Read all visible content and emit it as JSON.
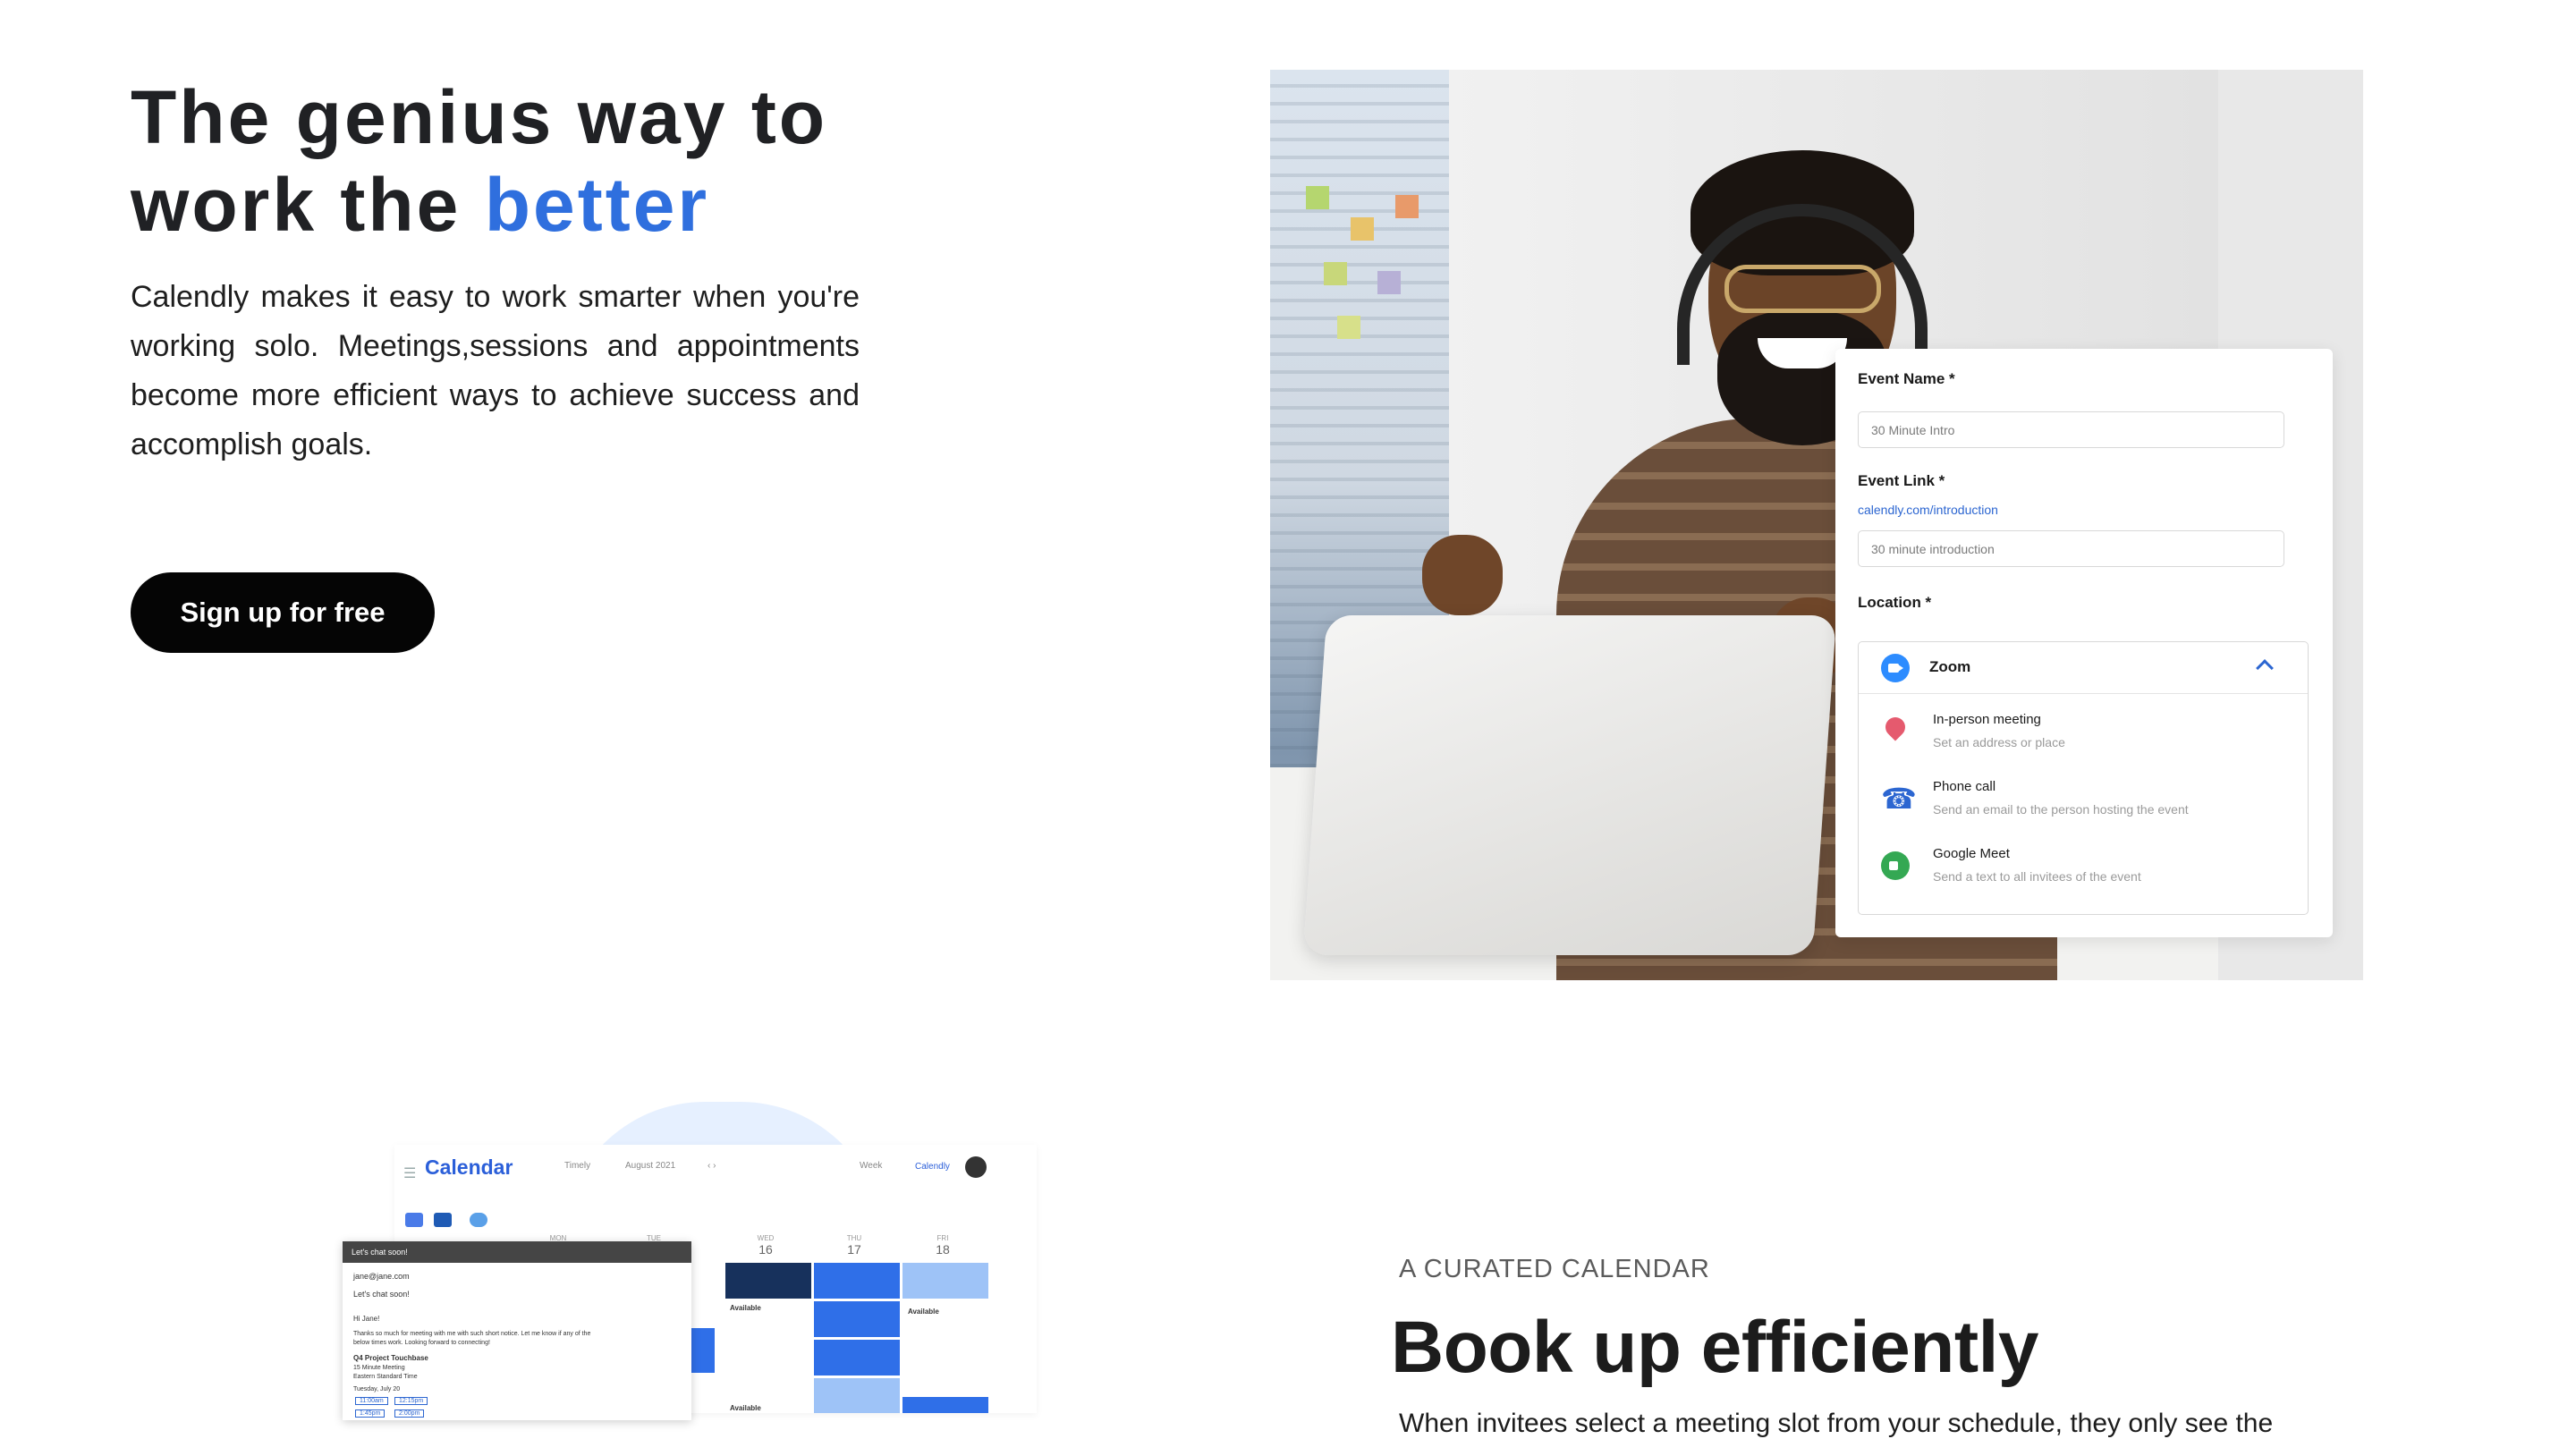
{
  "hero": {
    "title_line1": "The genius way to",
    "title_line2_prefix": "work the ",
    "title_line2_accent": "better",
    "description": "Calendly makes it easy to work smarter when you're working solo. Meetings,sessions and appointments become more efficient ways to achieve success and accomplish goals.",
    "cta_label": "Sign up for free"
  },
  "colors": {
    "accent": "#2f6fde",
    "cta_background": "#050505",
    "link": "#2c66d1"
  },
  "event_form": {
    "event_name_label": "Event Name *",
    "event_name_value": "30 Minute Intro",
    "event_link_label": "Event Link *",
    "event_link_url": "calendly.com/introduction",
    "event_link_value": "30 minute introduction",
    "location_label": "Location *",
    "location_selected": "Zoom",
    "location_options": [
      {
        "title": "In-person meeting",
        "subtitle": "Set an address or place",
        "icon": "map-pin-icon"
      },
      {
        "title": "Phone call",
        "subtitle": "Send an email to the person hosting the event",
        "icon": "phone-icon"
      },
      {
        "title": "Google Meet",
        "subtitle": "Send a text to all invitees of the event",
        "icon": "google-meet-icon"
      }
    ]
  },
  "calendar_preview": {
    "title": "Calendar",
    "view_select": "Timely",
    "month": "August 2021",
    "filter": "Week",
    "badge": "Calendly",
    "days": [
      {
        "name": "MON",
        "date": ""
      },
      {
        "name": "TUE",
        "date": ""
      },
      {
        "name": "WED",
        "date": "16"
      },
      {
        "name": "THU",
        "date": "17"
      },
      {
        "name": "FRI",
        "date": "18"
      }
    ],
    "available_label": "Available",
    "email": {
      "header": "Let's chat soon!",
      "to": "jane@jane.com",
      "subject": "Let's chat soon!",
      "greeting": "Hi Jane!",
      "body_line1": "Thanks so much for meeting with me with such short notice. Let me know if any of the",
      "body_line2": "below times work. Looking forward to connecting!",
      "meeting_name": "Q4 Project Touchbase",
      "meeting_length": "15 Minute Meeting",
      "meeting_tz": "Eastern Standard Time",
      "date_label": "Tuesday, July 20",
      "slots": [
        "11:00am",
        "12:15pm",
        "1:45pm",
        "2:00pm"
      ]
    }
  },
  "section2": {
    "eyebrow": "A CURATED CALENDAR",
    "title": "Book up efficiently",
    "description": "When invitees select a meeting slot from your schedule, they only see the"
  }
}
